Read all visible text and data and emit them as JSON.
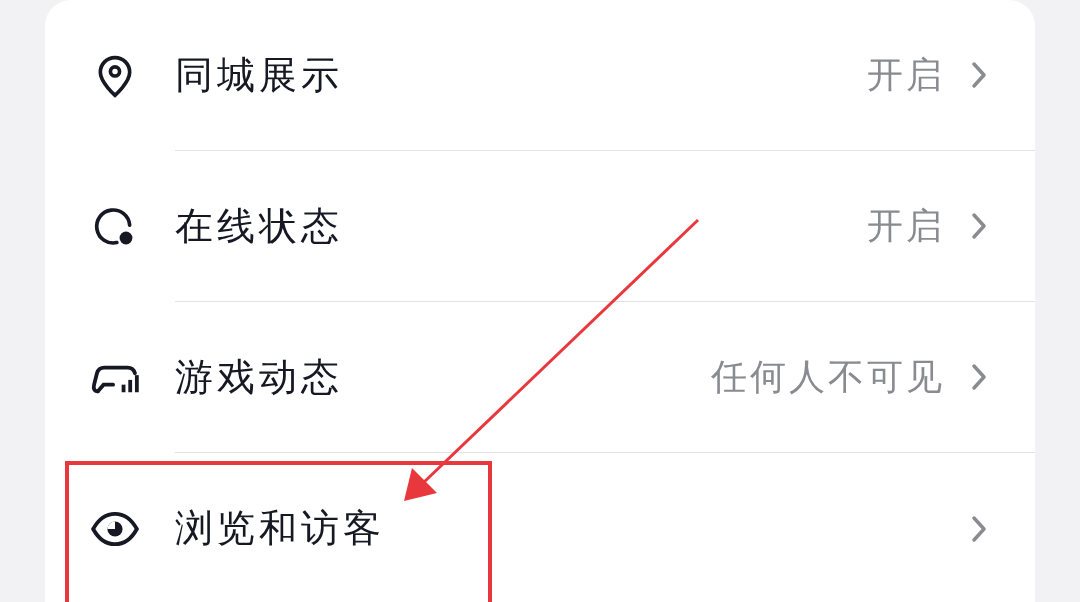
{
  "settings": [
    {
      "label": "同城展示",
      "value": "开启"
    },
    {
      "label": "在线状态",
      "value": "开启"
    },
    {
      "label": "游戏动态",
      "value": "任何人不可见"
    },
    {
      "label": "浏览和访客"
    }
  ]
}
